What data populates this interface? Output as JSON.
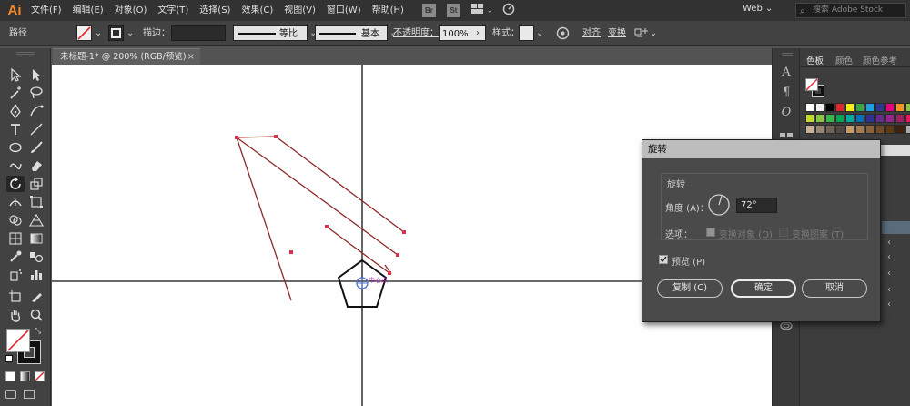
{
  "menubar": {
    "logo": "Ai",
    "items": [
      "文件(F)",
      "编辑(E)",
      "对象(O)",
      "文字(T)",
      "选择(S)",
      "效果(C)",
      "视图(V)",
      "窗口(W)",
      "帮助(H)"
    ],
    "bridge_label": "Br",
    "stock_label": "St",
    "workspace": "Web",
    "search_placeholder": "搜索 Adobe Stock"
  },
  "controlbar": {
    "selection_label": "路径",
    "stroke_label": "描边：",
    "profile_label": "等比",
    "brush_label": "基本",
    "opacity_label": "不透明度：",
    "opacity_value": "100%",
    "style_label": "样式：",
    "align_label": "对齐",
    "transform_label": "变换"
  },
  "document": {
    "tab_title": "未标题-1* @ 200% (RGB/预览)",
    "close_glyph": "×"
  },
  "panels": {
    "tabs": [
      "色板",
      "颜色",
      "颜色参考"
    ],
    "active_tab": "色板"
  },
  "dialog": {
    "title": "旋转",
    "group_title": "旋转",
    "angle_label": "角度 (A)：",
    "angle_value": "72°",
    "options_label": "选项：",
    "transform_objects_label": "变换对象 (O)",
    "transform_patterns_label": "变换图案 (T)",
    "preview_label": "预览 (P)",
    "copy_button": "复制 (C)",
    "ok_button": "确定",
    "cancel_button": "取消",
    "preview_checked": true,
    "transform_objects_checked": true,
    "transform_patterns_checked": false
  },
  "canvas": {
    "center_label": "中心点"
  },
  "colors": {
    "accent": "#f48a2a",
    "path_stroke": "#8b2a2a",
    "anchor": "#d8344b",
    "center_marker": "#4a6fd0",
    "center_label": "#c23cc6"
  }
}
